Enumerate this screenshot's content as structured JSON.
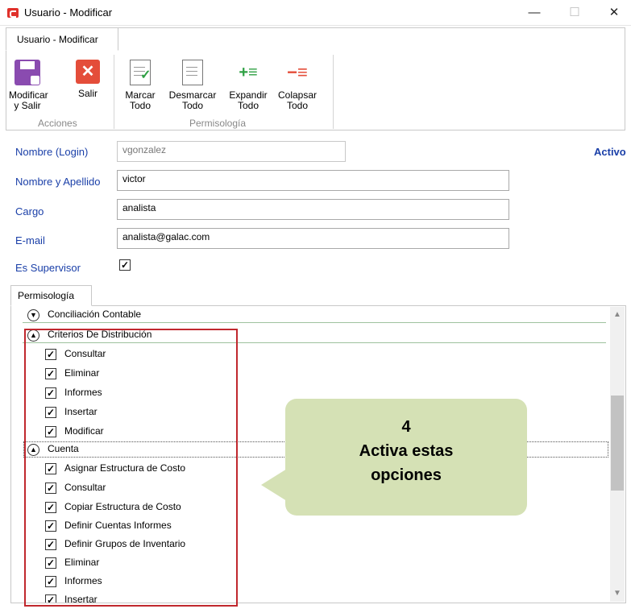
{
  "window": {
    "title": "Usuario - Modificar",
    "minimize": "—",
    "maximize": "☐",
    "close": "✕"
  },
  "ribbon": {
    "tab_label": "Usuario - Modificar",
    "groups": [
      {
        "label": "Acciones",
        "buttons": [
          {
            "label": "Modificar y Salir",
            "icon": "save-icon"
          },
          {
            "label": "Salir",
            "icon": "close-icon"
          }
        ]
      },
      {
        "label": "Permisología",
        "buttons": [
          {
            "label": "Marcar Todo",
            "icon": "check-document-icon"
          },
          {
            "label": "Desmarcar Todo",
            "icon": "document-icon"
          },
          {
            "label": "Expandir Todo",
            "icon": "expand-icon"
          },
          {
            "label": "Colapsar Todo",
            "icon": "collapse-icon"
          }
        ]
      }
    ]
  },
  "form": {
    "login_label": "Nombre (Login)",
    "login_value": "vgonzalez",
    "status": "Activo",
    "fullname_label": "Nombre y Apellido",
    "fullname_value": "victor",
    "cargo_label": "Cargo",
    "cargo_value": "analista",
    "email_label": "E-mail",
    "email_value": "analista@galac.com",
    "supervisor_label": "Es Supervisor",
    "supervisor_checked": true
  },
  "permissions": {
    "tab_label": "Permisología",
    "groups": [
      {
        "name": "Conciliación Contable",
        "expanded": false,
        "items": []
      },
      {
        "name": "Criterios De Distribución",
        "expanded": true,
        "items": [
          "Consultar",
          "Eliminar",
          "Informes",
          "Insertar",
          "Modificar"
        ]
      },
      {
        "name": "Cuenta",
        "expanded": true,
        "items": [
          "Asignar Estructura de Costo",
          "Consultar",
          "Copiar Estructura de Costo",
          "Definir Cuentas Informes",
          "Definir Grupos de Inventario",
          "Eliminar",
          "Informes",
          "Insertar"
        ]
      }
    ]
  },
  "callout": {
    "line1": "4",
    "line2": "Activa estas",
    "line3": "opciones",
    "color": "#d5e1b5"
  },
  "colors": {
    "highlight": "#c0282e",
    "label_blue": "#1a3fa8"
  }
}
